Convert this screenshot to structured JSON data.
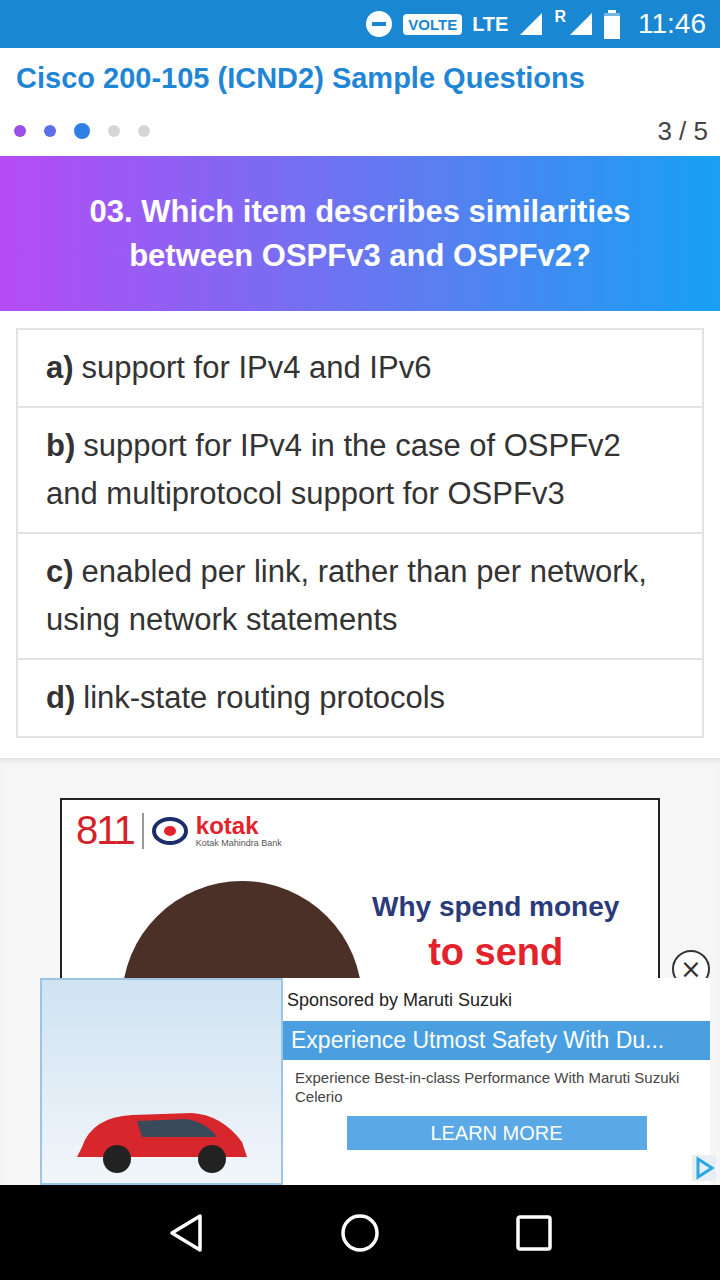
{
  "status_bar": {
    "badge": "VOLTE",
    "network": "LTE",
    "roaming": "R",
    "time": "11:46",
    "battery_level": 0.85
  },
  "app_bar": {
    "title": "Cisco 200-105 (ICND2) Sample Questions"
  },
  "pager": {
    "dots": [
      {
        "selected": false,
        "color": "#9b4fe6"
      },
      {
        "selected": false,
        "color": "#5c6ee8"
      },
      {
        "selected": true,
        "color": "#2f80e4"
      },
      {
        "selected": false,
        "color": "#d6d6d6"
      },
      {
        "selected": false,
        "color": "#d6d6d6"
      }
    ],
    "counter": "3 / 5"
  },
  "question": {
    "text": "03. Which item describes similarities between OSPFv3 and OSPFv2?"
  },
  "options": [
    {
      "letter": "a)",
      "text": "support for IPv4 and IPv6"
    },
    {
      "letter": "b)",
      "text": "support for IPv4 in the case of OSPFv2 and multiprotocol support for OSPFv3"
    },
    {
      "letter": "c)",
      "text": "enabled per link, rather than per network, using network statements"
    },
    {
      "letter": "d)",
      "text": "link-state routing protocols"
    }
  ],
  "ad": {
    "number": "811",
    "brand": "kotak",
    "brand_sub": "Kotak Mahindra Bank",
    "headline": "Why spend money",
    "headline2": "to send"
  },
  "sponsored": {
    "by": "Sponsored by Maruti Suzuki",
    "title": "Experience Utmost Safety With Du...",
    "body": "Experience Best-in-class Performance With Maruti Suzuki Celerio",
    "button": "LEARN MORE",
    "close": "×"
  }
}
